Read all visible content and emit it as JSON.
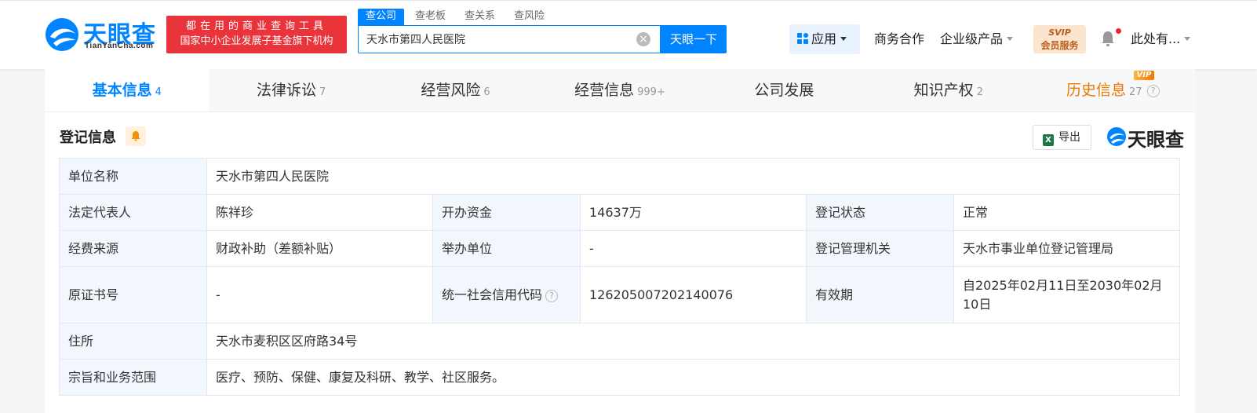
{
  "header": {
    "logo_cn": "天眼查",
    "logo_en": "TianYanCha.com",
    "slogan_line1": "都在用的商业查询工具",
    "slogan_line2": "国家中小企业发展子基金旗下机构",
    "search_tabs": [
      "查公司",
      "查老板",
      "查关系",
      "查风险"
    ],
    "search_value": "天水市第四人民医院",
    "search_button": "天眼一下",
    "nav_app": "应用",
    "nav_business": "商务合作",
    "nav_enterprise": "企业级产品",
    "svip_line1": "SVIP",
    "svip_line2": "会员服务",
    "user_name": "此处有..."
  },
  "tabs": [
    {
      "label": "基本信息",
      "count": "4"
    },
    {
      "label": "法律诉讼",
      "count": "7"
    },
    {
      "label": "经营风险",
      "count": "6"
    },
    {
      "label": "经营信息",
      "count": "999+"
    },
    {
      "label": "公司发展",
      "count": ""
    },
    {
      "label": "知识产权",
      "count": "2"
    },
    {
      "label": "历史信息",
      "count": "27"
    }
  ],
  "vip_tag": "VIP",
  "section": {
    "title": "登记信息",
    "export_label": "导出",
    "watermark": "天眼查"
  },
  "info": {
    "unit_name_label": "单位名称",
    "unit_name": "天水市第四人民医院",
    "legal_rep_label": "法定代表人",
    "legal_rep": "陈祥珍",
    "capital_label": "开办资金",
    "capital": "14637万",
    "reg_status_label": "登记状态",
    "reg_status": "正常",
    "funding_label": "经费来源",
    "funding": "财政补助（差额补贴）",
    "organizer_label": "举办单位",
    "organizer": "-",
    "authority_label": "登记管理机关",
    "authority": "天水市事业单位登记管理局",
    "orig_cert_label": "原证书号",
    "orig_cert": "-",
    "credit_code_label": "统一社会信用代码",
    "credit_code": "126205007202140076",
    "validity_label": "有效期",
    "validity": "自2025年02月11日至2030年02月10日",
    "address_label": "住所",
    "address": "天水市麦积区区府路34号",
    "scope_label": "宗旨和业务范围",
    "scope": "医疗、预防、保健、康复及科研、教学、社区服务。"
  },
  "colors": {
    "brand_blue": "#0084ff",
    "slogan_red": "#e8343a",
    "history_orange": "#f07800"
  }
}
